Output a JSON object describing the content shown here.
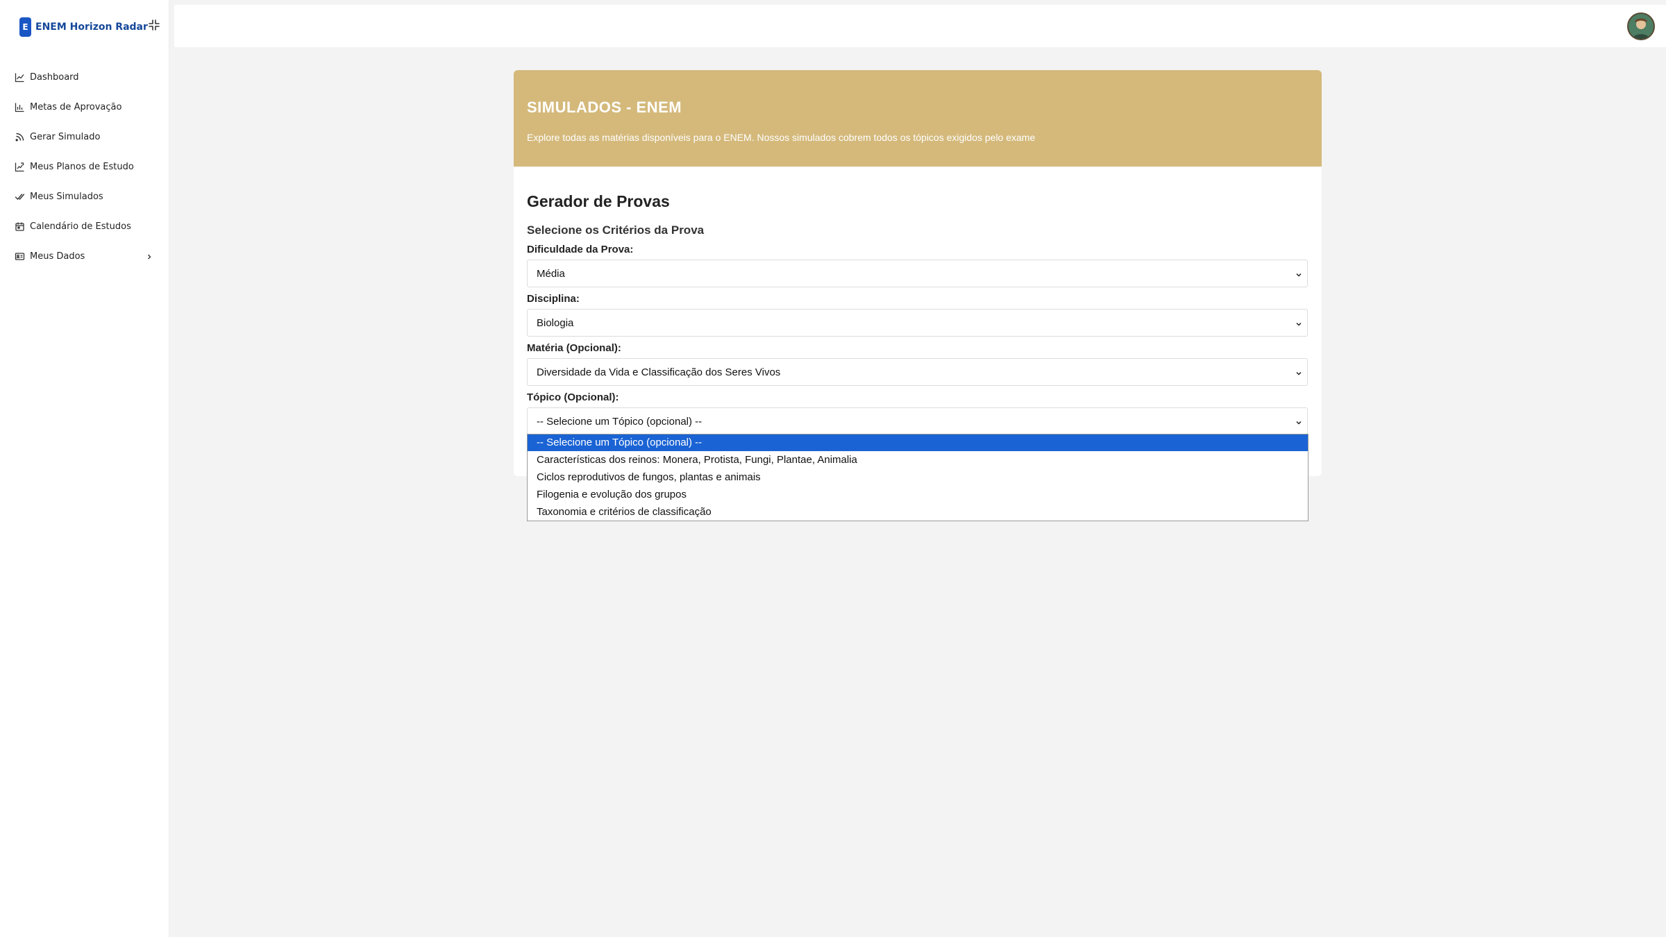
{
  "brand": {
    "logo_letter": "E",
    "name": "ENEM Horizon Radar"
  },
  "sidebar": {
    "items": [
      {
        "label": "Dashboard",
        "icon": "chart-line-icon"
      },
      {
        "label": "Metas de Aprovação",
        "icon": "bar-chart-icon"
      },
      {
        "label": "Gerar Simulado",
        "icon": "feed-icon"
      },
      {
        "label": "Meus Planos de Estudo",
        "icon": "chart-plan-icon"
      },
      {
        "label": "Meus Simulados",
        "icon": "double-check-icon"
      },
      {
        "label": "Calendário de Estudos",
        "icon": "calendar-icon"
      },
      {
        "label": "Meus Dados",
        "icon": "id-card-icon"
      }
    ]
  },
  "hero": {
    "title": "SIMULADOS - ENEM",
    "description": "Explore todas as matérias disponíveis para o ENEM. Nossos simulados cobrem todos os tópicos exigidos pelo exame"
  },
  "generator": {
    "title": "Gerador de Provas",
    "subtitle": "Selecione os Critérios da Prova",
    "fields": [
      {
        "label": "Dificuldade da Prova:",
        "value": "Média"
      },
      {
        "label": "Disciplina:",
        "value": "Biologia"
      },
      {
        "label": "Matéria (Opcional):",
        "value": "Diversidade da Vida e Classificação dos Seres Vivos"
      },
      {
        "label": "Tópico (Opcional):",
        "value": "-- Selecione um Tópico (opcional) --"
      }
    ]
  },
  "topic_dropdown": {
    "options": [
      "-- Selecione um Tópico (opcional) --",
      "Características dos reinos: Monera, Protista, Fungi, Plantae, Animalia",
      "Ciclos reprodutivos de fungos, plantas e animais",
      "Filogenia e evolução dos grupos",
      "Taxonomia e critérios de classificação"
    ],
    "selected_index": 0
  },
  "colors": {
    "accent": "#d4b97b",
    "brand": "#1a56c4",
    "option_highlight": "#1a63d4"
  }
}
